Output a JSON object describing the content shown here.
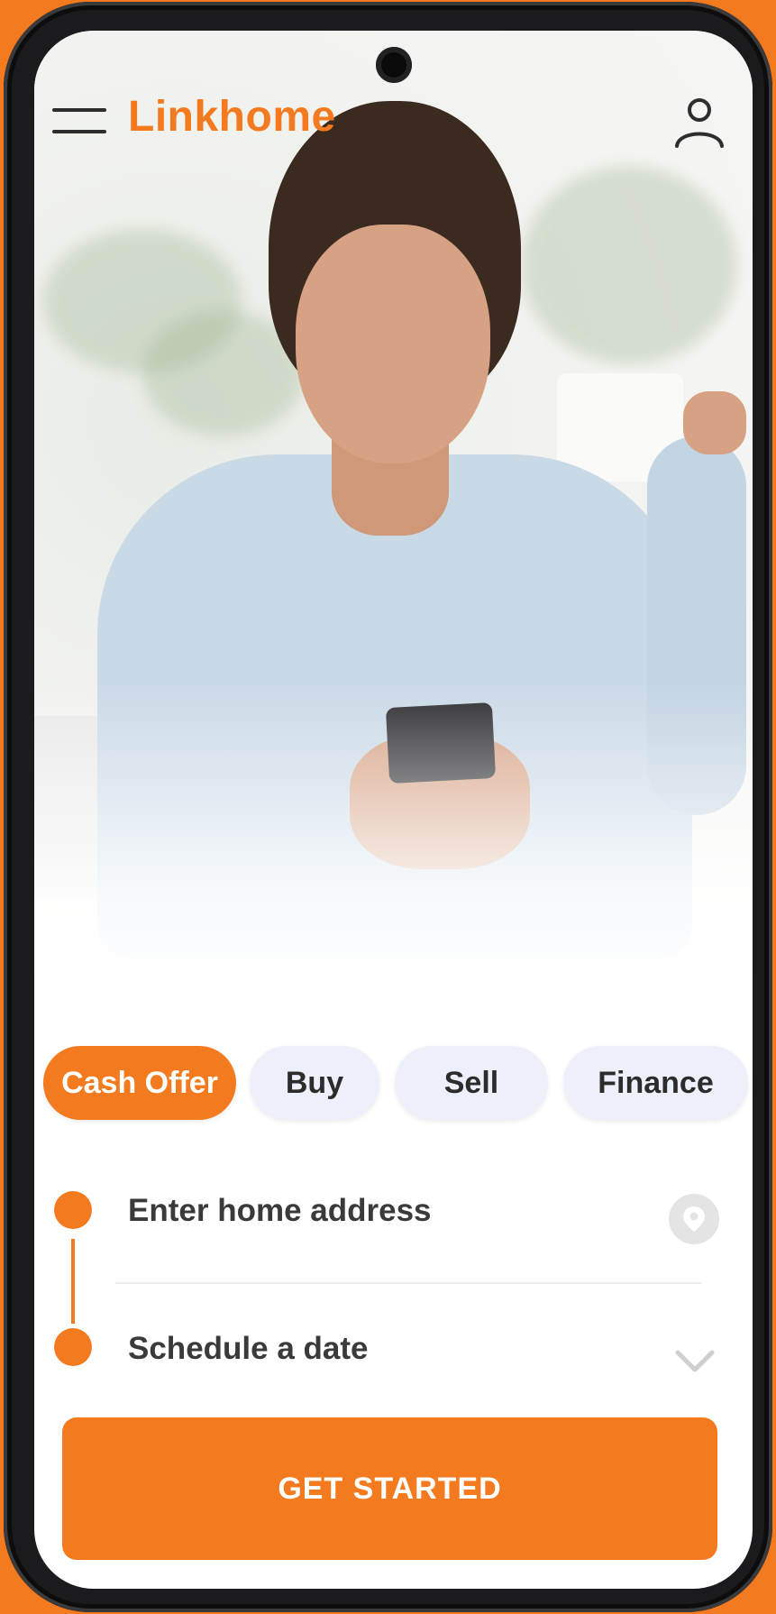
{
  "brand": {
    "name": "Linkhome",
    "accent_color": "#f47a1f"
  },
  "header": {
    "menu_icon": "hamburger-menu-icon",
    "profile_icon": "user-profile-icon"
  },
  "tabs": [
    {
      "label": "Cash Offer",
      "active": true
    },
    {
      "label": "Buy",
      "active": false
    },
    {
      "label": "Sell",
      "active": false
    },
    {
      "label": "Finance",
      "active": false
    }
  ],
  "form": {
    "address_placeholder": "Enter home address",
    "address_icon": "location-pin-icon",
    "date_placeholder": "Schedule a date",
    "date_icon": "chevron-down-icon"
  },
  "cta": {
    "label": "GET STARTED"
  }
}
